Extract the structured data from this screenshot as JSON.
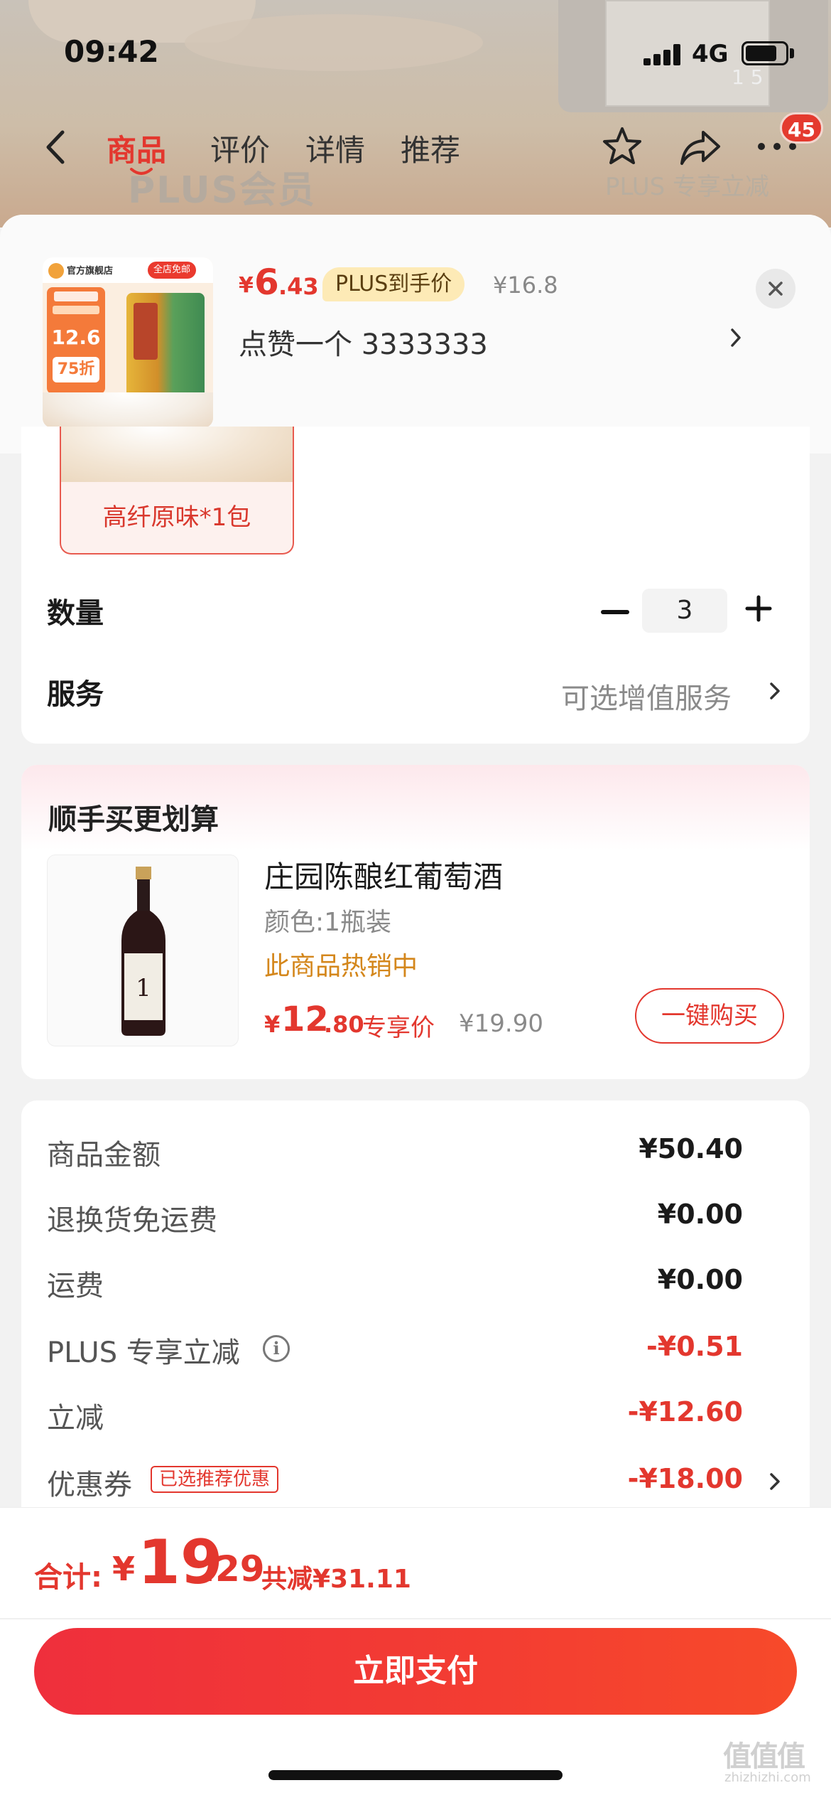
{
  "status_bar": {
    "time": "09:42",
    "network": "4G"
  },
  "background_page": {
    "plus_member_text": "PLUS会员",
    "plus_discount_text": "PLUS 专享立减",
    "image_counter": "1  5"
  },
  "nav": {
    "tabs": [
      "商品",
      "评价",
      "详情",
      "推荐"
    ],
    "active_tab": "商品",
    "cart_badge": "45"
  },
  "sheet_header": {
    "product_image": {
      "brand": "官方旗舰店",
      "free_shipping": "全店免邮",
      "price_tag": "12.6",
      "discount_tag": "75折"
    },
    "price_symbol": "¥",
    "price_int": "6",
    "price_dec": ".43",
    "plus_tag": "PLUS到手价",
    "original_price": "¥16.8",
    "selection_text": "点赞一个  3333333"
  },
  "option": {
    "label": "高纤原味*1包"
  },
  "quantity": {
    "label": "数量",
    "value": "3"
  },
  "service": {
    "label": "服务",
    "value": "可选增值服务"
  },
  "upsell": {
    "title": "顺手买更划算",
    "product_name": "庄园陈酿红葡萄酒",
    "spec": "颜色:1瓶装",
    "hot_text": "此商品热销中",
    "price_symbol": "¥",
    "price_int": "12",
    "price_dec": ".80",
    "price_tag": "专享价",
    "original_price": "¥19.90",
    "buy_button": "一键购买"
  },
  "summary": [
    {
      "label": "商品金额",
      "value": "¥50.40",
      "highlight": false
    },
    {
      "label": "退换货免运费",
      "value": "¥0.00",
      "highlight": false
    },
    {
      "label": "运费",
      "value": "¥0.00",
      "highlight": false
    },
    {
      "label": "PLUS 专享立减",
      "value": "-¥0.51",
      "highlight": true
    },
    {
      "label": "立减",
      "value": "-¥12.60",
      "highlight": true
    },
    {
      "label": "优惠券",
      "value": "-¥18.00",
      "highlight": true,
      "tag": "已选推荐优惠"
    }
  ],
  "bottom_bar": {
    "total_label": "合计:",
    "total_symbol": "¥",
    "total_int": "19",
    "total_dec": ".29",
    "total_savings": "共减¥31.11",
    "pay_button": "立即支付"
  },
  "watermark": {
    "text": "值值值",
    "url": "zhizhizhi.com"
  },
  "colors": {
    "accent": "#e3372e",
    "gold": "#d4871c",
    "plus_tag_bg": "#fdeab6"
  }
}
